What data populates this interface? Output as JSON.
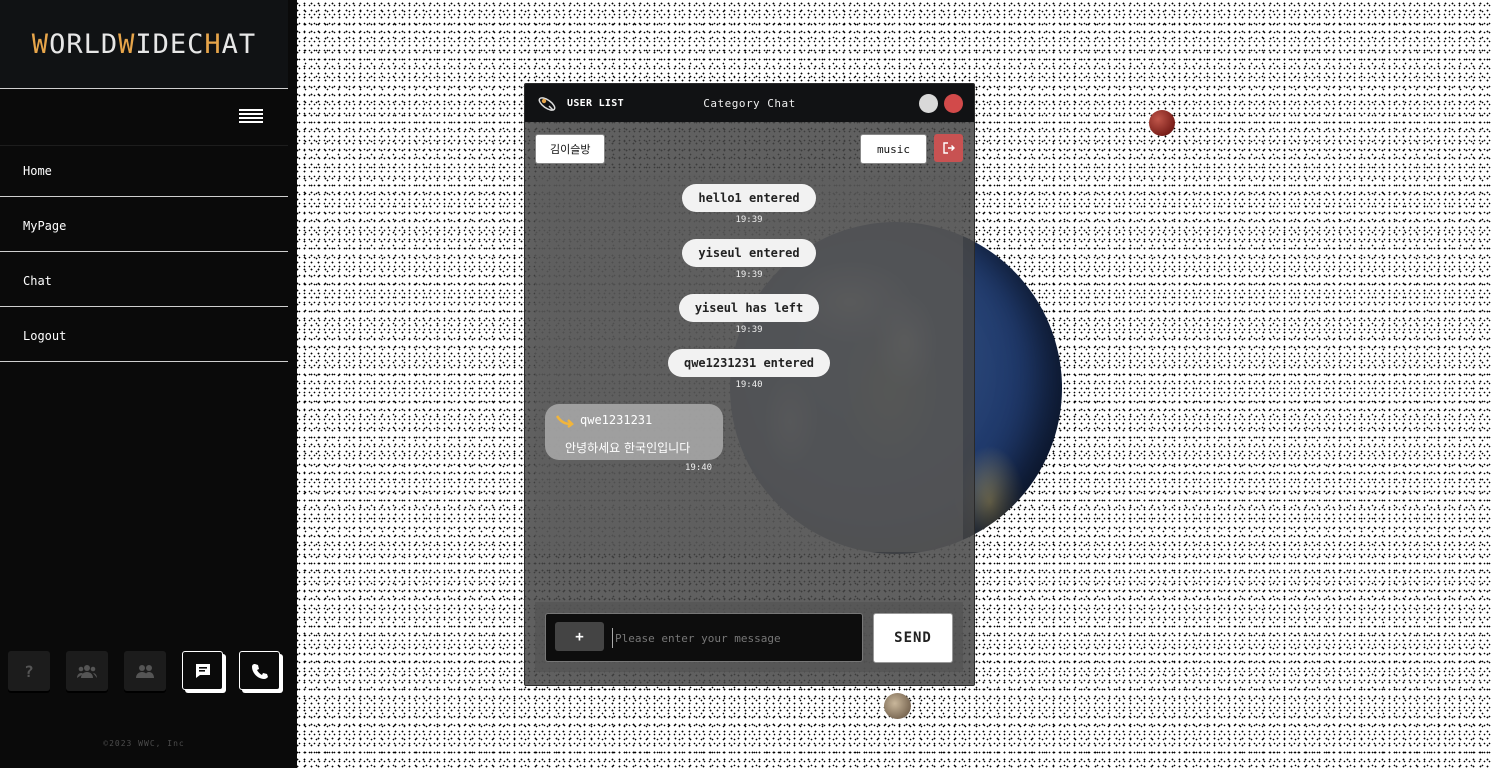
{
  "brand": {
    "part1_accent": "W",
    "part1_rest": "ORLD ",
    "part2_accent": "W",
    "part2_rest": "IDE ",
    "part3_rest": "C",
    "part3_accent": "H",
    "part3_end": "AT"
  },
  "sidebar": {
    "items": [
      {
        "label": "Home"
      },
      {
        "label": "MyPage"
      },
      {
        "label": "Chat"
      },
      {
        "label": "Logout"
      }
    ],
    "tools": [
      {
        "icon": "question-icon",
        "label": "?"
      },
      {
        "icon": "group-icon"
      },
      {
        "icon": "people-icon"
      },
      {
        "icon": "chat-icon"
      },
      {
        "icon": "phone-icon"
      }
    ],
    "copyright": "©2023 WWC, Inc"
  },
  "chat_window": {
    "user_list_label": "USER LIST",
    "title": "Category Chat",
    "room_name": "김이슬방",
    "music_label": "music",
    "system_messages": [
      {
        "text": "hello1 entered",
        "time": "19:39"
      },
      {
        "text": "yiseul entered",
        "time": "19:39"
      },
      {
        "text": "yiseul has left",
        "time": "19:39"
      },
      {
        "text": "qwe1231231 entered",
        "time": "19:40"
      }
    ],
    "user_message": {
      "username": "qwe1231231",
      "text": "안녕하세요  한국인입니다",
      "time": "19:40"
    },
    "input": {
      "placeholder": "Please enter your message",
      "value": ""
    },
    "plus_label": "+",
    "send_label": "SEND"
  },
  "colors": {
    "accent_brand": "#e7a54a",
    "close": "#d24a4a",
    "exit": "#c85252"
  }
}
